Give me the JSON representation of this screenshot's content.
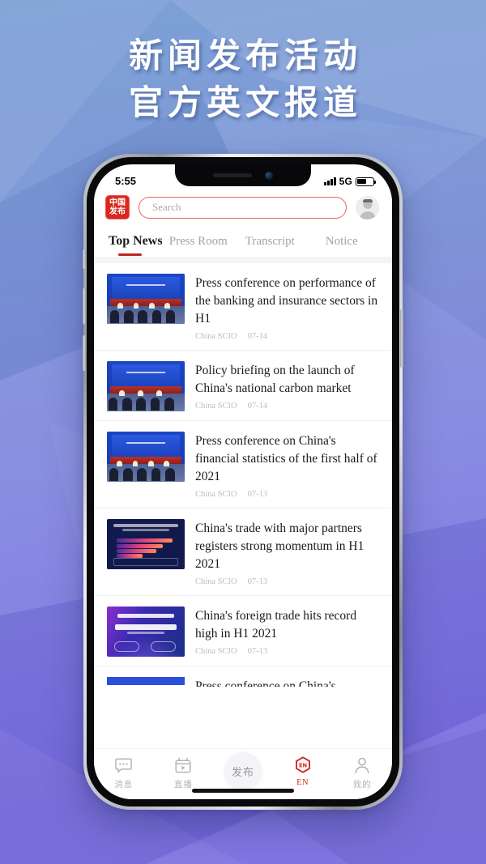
{
  "poster": {
    "headline_line1": "新闻发布活动",
    "headline_line2": "官方英文报道",
    "bg_top_color": "#7ba0d4",
    "bg_bottom_color": "#7a6ee2"
  },
  "phone": {
    "status_bar": {
      "time": "5:55",
      "network": "5G",
      "signal_icon": "signal-bars-icon",
      "battery_icon": "battery-icon"
    },
    "app_bar": {
      "logo_line1": "中国",
      "logo_line2": "发布",
      "logo_color": "#d8281f",
      "search_placeholder": "Search",
      "search_border_color": "#e2635c",
      "avatar_icon": "avatar-icon"
    },
    "tabs": {
      "active_index": 0,
      "accent_color": "#c0241c",
      "items": [
        {
          "label": "Top News"
        },
        {
          "label": "Press Room"
        },
        {
          "label": "Transcript"
        },
        {
          "label": "Notice"
        }
      ]
    },
    "news": [
      {
        "title": "Press conference on performance of the banking and insurance sectors in H1",
        "source": "China SCIO",
        "date": "07-14",
        "thumb": "press-conference-photo"
      },
      {
        "title": "Policy briefing on the launch of China's national carbon market",
        "source": "China SCIO",
        "date": "07-14",
        "thumb": "press-conference-photo"
      },
      {
        "title": "Press conference on China's financial statistics of the first half of 2021",
        "source": "China SCIO",
        "date": "07-13",
        "thumb": "press-conference-photo"
      },
      {
        "title": "China's trade with major partners registers strong momentum in H1 2021",
        "source": "China SCIO",
        "date": "07-13",
        "thumb": "trade-infographic"
      },
      {
        "title": "China's foreign trade hits record high in H1 2021",
        "source": "China SCIO",
        "date": "07-13",
        "thumb": "foreign-trade-infographic"
      },
      {
        "title": "Press conference on China's",
        "source": "",
        "date": "",
        "thumb": "clipped-thumbnail"
      }
    ],
    "tabbar": {
      "active_label": "EN",
      "active_color": "#cf2a22",
      "items": [
        {
          "label": "消息",
          "icon": "message-bubble-icon"
        },
        {
          "label": "直播",
          "icon": "live-video-icon"
        },
        {
          "label": "发布",
          "icon": "publish-center-button"
        },
        {
          "label": "EN",
          "icon": "en-hexagon-icon"
        },
        {
          "label": "我的",
          "icon": "person-icon"
        }
      ]
    }
  }
}
